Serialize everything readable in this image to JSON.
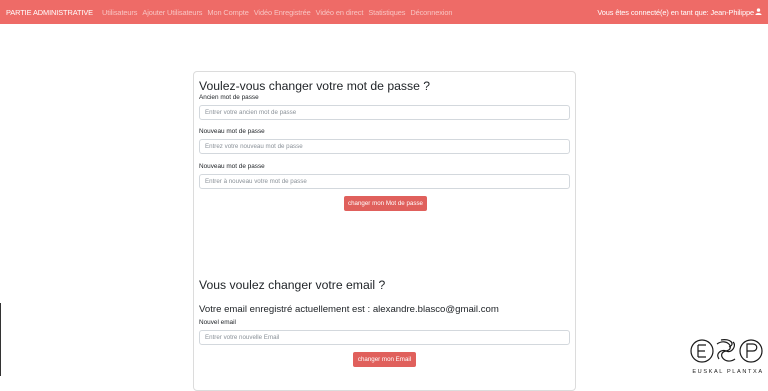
{
  "navbar": {
    "brand": "PARTIE ADMINISTRATIVE",
    "links": [
      "Utilisateurs",
      "Ajouter Utilisateurs",
      "Mon Compte",
      "Vidéo Enregistrée",
      "Vidéo en direct",
      "Statistiques",
      "Déconnexion"
    ],
    "user_status": "Vous êtes connecté(e) en tant que: Jean-Philippe",
    "user_icon": "user-icon",
    "bg_color": "#ee6b67"
  },
  "password_section": {
    "title": "Voulez-vous changer votre mot de passe ?",
    "old_label": "Ancien mot de passe",
    "old_placeholder": "Entrer votre ancien mot de passe",
    "new_label": "Nouveau mot de passe",
    "new_placeholder": "Entrez votre nouveau mot de passe",
    "confirm_label": "Nouveau mot de passe",
    "confirm_placeholder": "Entrer à nouveau votre mot de passe",
    "button": "changer mon Mot de passe"
  },
  "email_section": {
    "title": "Vous voulez changer votre email ?",
    "current_text": "Votre email enregistré actuellement est : alexandre.blasco@gmail.com",
    "new_label": "Nouvel email",
    "new_placeholder": "Entrer votre nouvelle Email",
    "button": "changer mon Email"
  },
  "logo": {
    "text": "EUSKAL PLANTXA"
  }
}
